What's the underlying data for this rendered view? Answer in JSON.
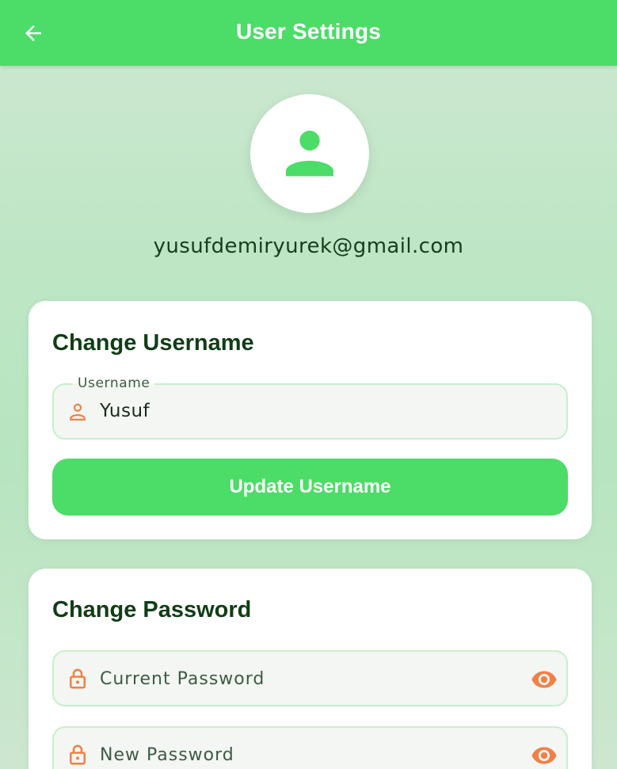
{
  "appbar": {
    "title": "User Settings",
    "back_icon": "arrow-left-icon"
  },
  "profile": {
    "avatar_icon": "person-icon",
    "email": "yusufdemiryurek@gmail.com"
  },
  "change_username": {
    "title": "Change Username",
    "field": {
      "label": "Username",
      "value": "Yusuf",
      "icon": "person-outline-icon"
    },
    "button_label": "Update Username"
  },
  "change_password": {
    "title": "Change Password",
    "current_password": {
      "placeholder": "Current Password",
      "icon": "lock-icon",
      "toggle_icon": "eye-icon"
    },
    "new_password": {
      "placeholder": "New Password",
      "icon": "lock-icon",
      "toggle_icon": "eye-icon"
    }
  },
  "colors": {
    "primary": "#4cdc68",
    "accent_icon": "#f08048",
    "card_title": "#113d16"
  }
}
